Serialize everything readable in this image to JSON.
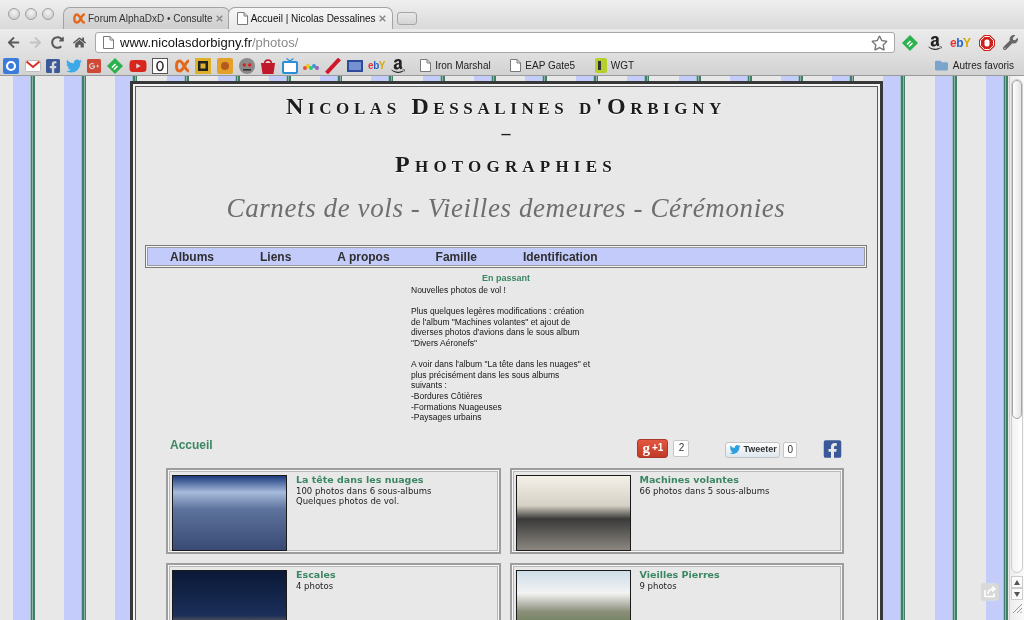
{
  "window": {
    "tabs": [
      {
        "kind": "site",
        "title": "Forum AlphaDxD • Consulte",
        "selected": false
      },
      {
        "kind": "page",
        "title": "Accueil | Nicolas Dessalines",
        "selected": true
      }
    ]
  },
  "toolbar": {
    "buttons": [
      {
        "kind": "back",
        "disabled": false
      },
      {
        "kind": "forward",
        "disabled": true
      },
      {
        "kind": "reload",
        "disabled": false
      },
      {
        "kind": "home",
        "disabled": false
      }
    ],
    "address": {
      "host": "www.nicolasdorbigny.fr",
      "path": "/photos/"
    },
    "logo_button": {
      "text": "ebY"
    }
  },
  "bookmarks_bar": {
    "logo_bookmark": {
      "text": "ebY"
    },
    "items": [
      {
        "kind": "page",
        "label": "Iron Marshal"
      },
      {
        "kind": "page",
        "label": "EAP Gate5"
      },
      {
        "kind": "app",
        "label": "WGT"
      }
    ],
    "other": {
      "label": "Autres favoris"
    }
  },
  "header": {
    "title": "Nicolas Dessalines d'Orbigny",
    "separator": "–",
    "subtitle": "Photographies",
    "tagline": "Carnets de vols - Vieilles demeures - Cérémonies"
  },
  "nav": [
    "Albums",
    "Liens",
    "A propos",
    "Famille",
    "Identification"
  ],
  "news": {
    "title": "En passant",
    "paragraphs": [
      "Nouvelles photos de vol !",
      "Plus quelques legères modifications : création\nde l'album \"Machines volantes\" et ajout de\ndiverses photos d'avions dans le sous album\n\"Divers Aéronefs\"",
      "A voir dans l'album \"La tête dans les nuages\" et\nplus précisément dans les sous albums\nsuivants :\n-Bordures Côtières\n-Formations Nuageuses\n-Paysages urbains"
    ]
  },
  "breadcrumb": "Accueil",
  "social": {
    "plus_one": {
      "logo": "g",
      "label": "+1",
      "count": "2"
    },
    "tweet": {
      "label": "Tweeter",
      "count": "0"
    }
  },
  "albums": [
    {
      "title": "La tête dans les nuages",
      "count": "100 photos dans 6 sous-albums",
      "description": "Quelques photos de vol."
    },
    {
      "title": "Machines volantes",
      "count": "66 photos dans 5 sous-albums"
    },
    {
      "title": "Escales",
      "count": "4 photos"
    },
    {
      "title": "Vieilles Pierres",
      "count": "9 photos"
    }
  ]
}
